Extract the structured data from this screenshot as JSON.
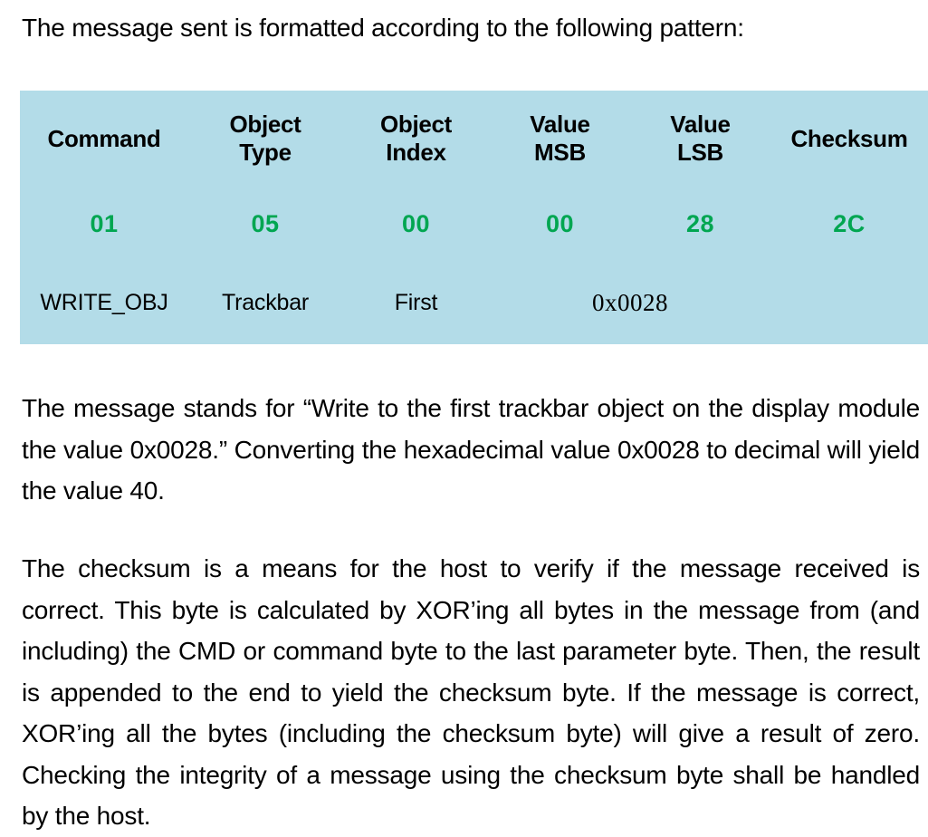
{
  "intro": {
    "text": "The message sent is formatted according to the following pattern:"
  },
  "table": {
    "background_color": "#b3dce8",
    "hex_color": "#00a651",
    "headers": [
      {
        "line1": "Command",
        "line2": ""
      },
      {
        "line1": "Object",
        "line2": "Type"
      },
      {
        "line1": "Object",
        "line2": "Index"
      },
      {
        "line1": "Value",
        "line2": "MSB"
      },
      {
        "line1": "Value",
        "line2": "LSB"
      },
      {
        "line1": "Checksum",
        "line2": ""
      }
    ],
    "hex_values": [
      "01",
      "05",
      "00",
      "00",
      "28",
      "2C"
    ],
    "descriptions": {
      "command": "WRITE_OBJ",
      "object_type": "Trackbar",
      "object_index": "First",
      "value_combined": "0x0028",
      "checksum": ""
    }
  },
  "paragraphs": {
    "p1": "The message stands for “Write to the first trackbar object on the display module the value 0x0028.” Converting the hexadecimal value 0x0028 to decimal will yield the value 40.",
    "p2": "The checksum is a means for the host to verify if the message received is correct. This byte is calculated by XOR’ing all bytes in the message from (and including) the CMD or command byte to the last parameter byte. Then, the result is appended to the end to yield the checksum byte. If the message is correct, XOR’ing all the bytes (including the checksum byte) will give a result of zero. Checking the integrity of a message using the checksum byte shall be handled by the host."
  }
}
